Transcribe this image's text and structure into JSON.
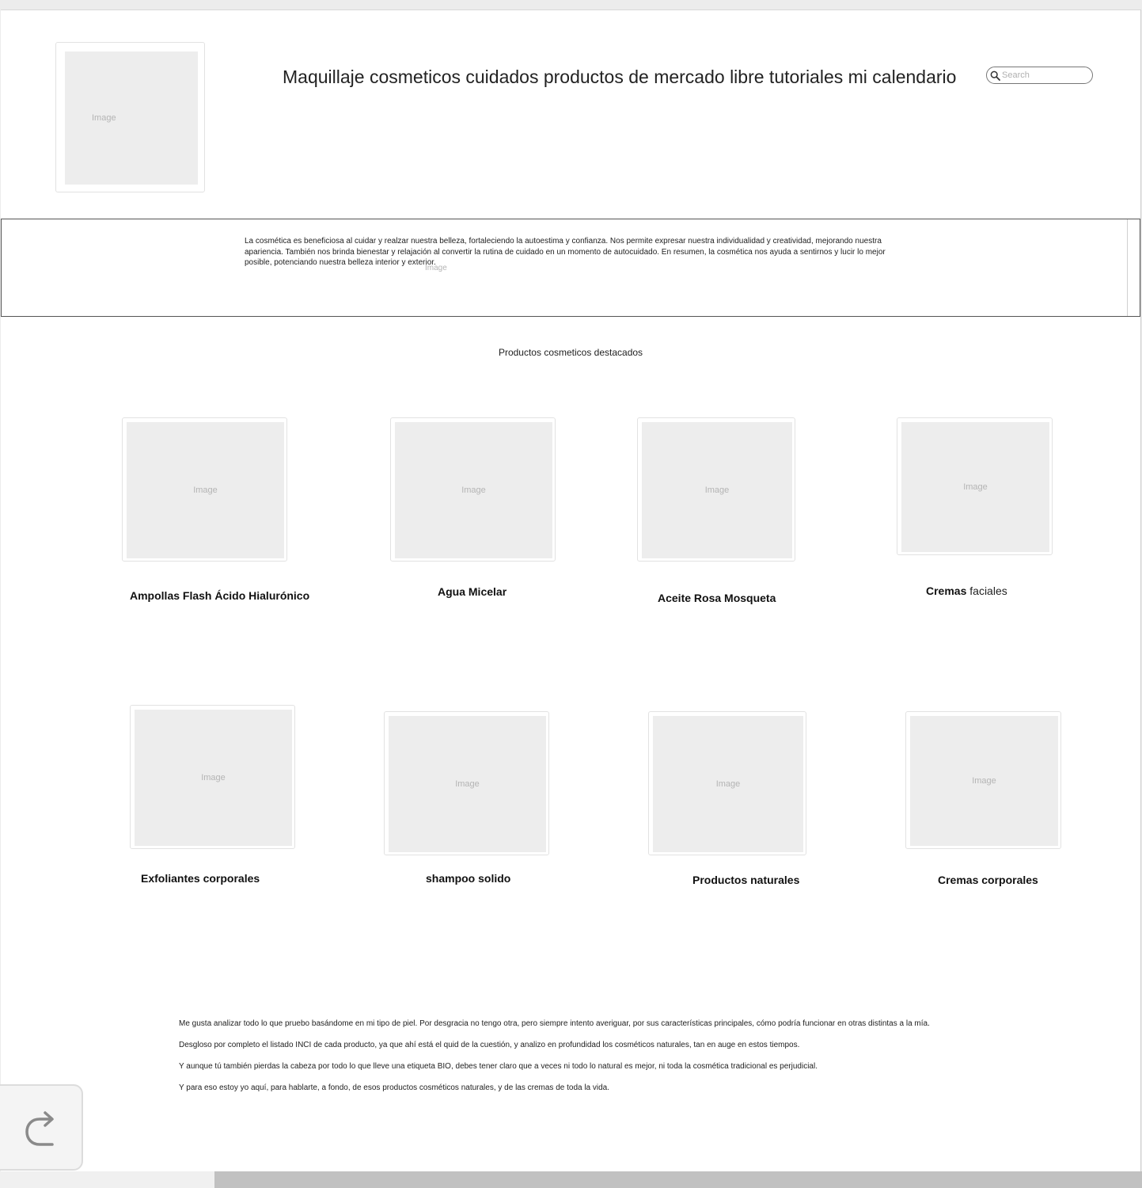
{
  "header": {
    "logo_placeholder": "Image",
    "title": "Maquillaje cosmeticos cuidados productos de mercado libre tutoriales mi calendario",
    "search_placeholder": "Search"
  },
  "intro": {
    "text": "La cosmética es beneficiosa al cuidar y realzar nuestra belleza, fortaleciendo la autoestima y confianza. Nos permite expresar nuestra individualidad y creatividad, mejorando nuestra apariencia. También nos brinda bienestar y relajación al convertir la rutina de cuidado en un momento de autocuidado. En resumen, la cosmética nos ayuda a sentirnos y lucir lo mejor posible, potenciando nuestra belleza interior y exterior.",
    "image_placeholder": "Image"
  },
  "featured": {
    "heading": "Productos cosmeticos destacados",
    "image_placeholder": "Image",
    "products": [
      {
        "name": "Ampollas Flash Ácido Hialurónico"
      },
      {
        "name": "Agua Micelar"
      },
      {
        "name": "Aceite Rosa Mosqueta"
      },
      {
        "name_bold": "Cremas",
        "name_rest": " faciales"
      },
      {
        "name": "Exfoliantes corporales"
      },
      {
        "name": "shampoo solido"
      },
      {
        "name": "Productos naturales"
      },
      {
        "name": "Cremas corporales"
      }
    ]
  },
  "outro": {
    "paragraphs": [
      "Me gusta analizar todo lo que pruebo basándome en mi tipo de piel. Por desgracia no tengo otra, pero siempre intento averiguar, por sus características principales, cómo podría funcionar en otras distintas a la mía.",
      "Desgloso por completo el listado INCI de cada producto, ya que ahí está el quid de la cuestión, y analizo en profundidad los cosméticos naturales, tan en auge en estos tiempos.",
      "Y aunque tú también pierdas la cabeza por todo lo que lleve una etiqueta BIO, debes tener claro que a veces ni todo lo natural es mejor, ni toda la cosmética tradicional es perjudicial.",
      "Y para eso estoy yo aquí, para hablarte, a fondo, de esos productos cosméticos naturales, y de las cremas de toda la vida."
    ]
  },
  "icons": {
    "search": "search-icon",
    "redo": "redo-icon"
  }
}
